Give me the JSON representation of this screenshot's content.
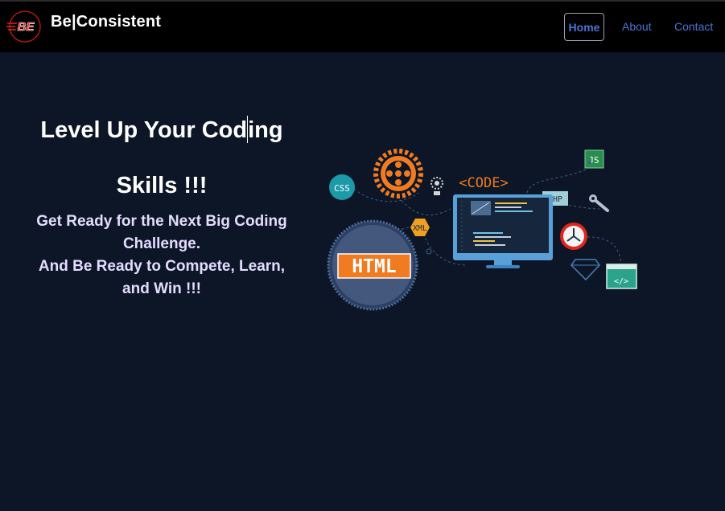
{
  "header": {
    "brand": "Be|Consistent",
    "logo_text": "BE",
    "nav": {
      "home": "Home",
      "about": "About",
      "contact": "Contact"
    }
  },
  "hero": {
    "title_line1_a": "Level Up Your Cod",
    "title_line1_b": "ing",
    "title_line2": "Skills !!!",
    "subtitle_line1": "Get Ready for the Next Big Coding",
    "subtitle_line2": "Challenge.",
    "subtitle_line3": "And Be Ready to Compete, Learn,",
    "subtitle_line4": "and Win !!!"
  },
  "illustration": {
    "code_label": "<CODE>",
    "css_label": "CSS",
    "js_label": "JS",
    "php_label": "PHP",
    "xml_label": "XML",
    "html_label": "HTML",
    "tag_label": "</>"
  },
  "colors": {
    "background": "#0c1627",
    "header": "#000000",
    "accent_link": "#4a74d8",
    "logo_red": "#e0261e",
    "orange": "#f07b21"
  }
}
